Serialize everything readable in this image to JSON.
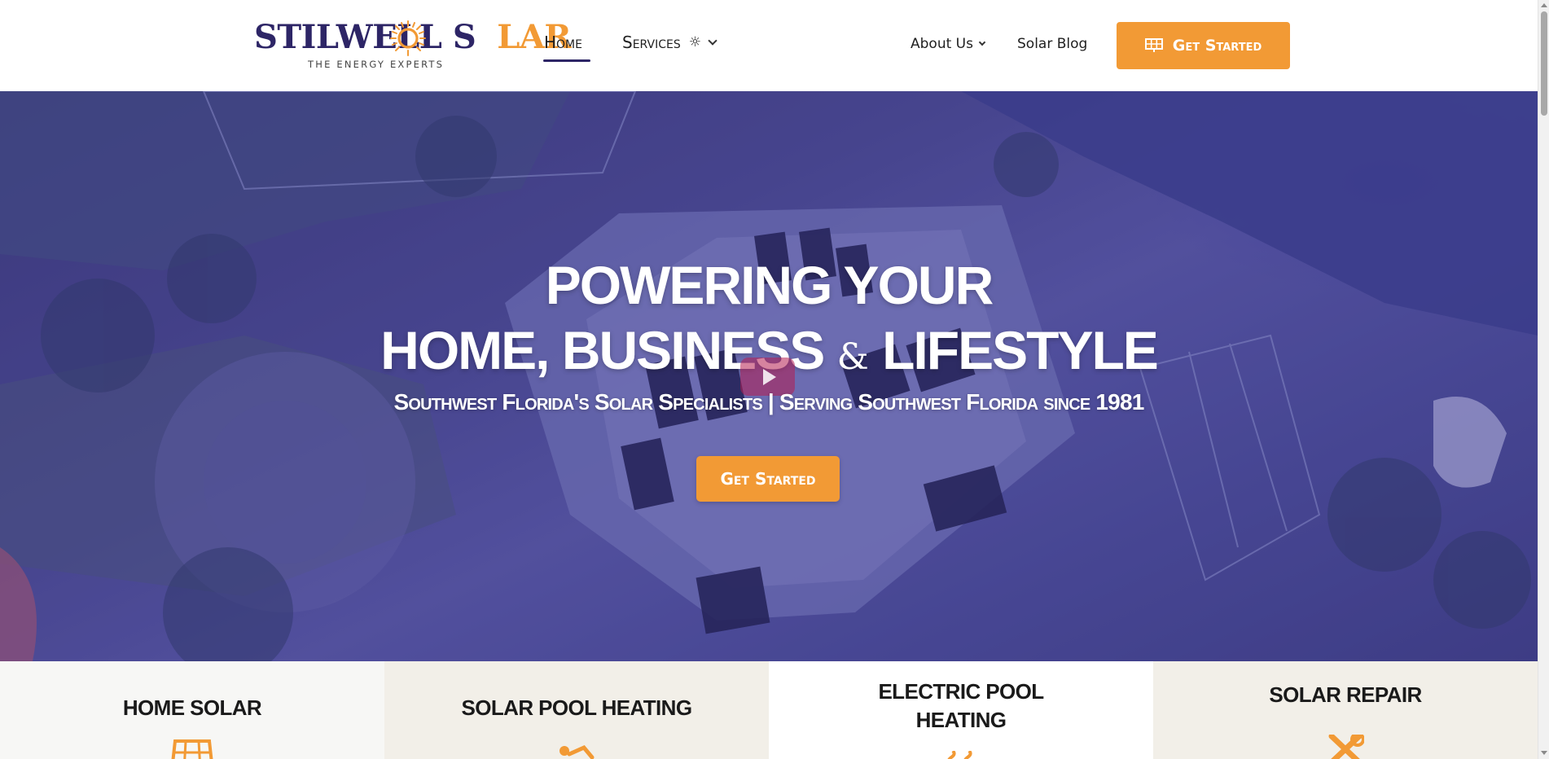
{
  "header": {
    "logo": {
      "word_part1": "STILWELL S",
      "word_part2": "LAR",
      "tagline": "THE ENERGY EXPERTS"
    },
    "nav": {
      "home": "Home",
      "services": "Services",
      "about": "About Us",
      "blog": "Solar Blog"
    },
    "cta_label": "Get Started"
  },
  "hero": {
    "title_line1": "POWERING YOUR",
    "title_line2_a": "HOME, BUSINESS ",
    "title_line2_amp": "&",
    "title_line2_b": " LIFESTYLE",
    "subtitle": "Southwest Florida's Solar Specialists | Serving Southwest Florida since 1981",
    "cta_label": "Get Started"
  },
  "services": [
    {
      "title": "HOME SOLAR",
      "icon": "solar-panel-icon"
    },
    {
      "title": "SOLAR POOL HEATING",
      "icon": "swimmer-icon"
    },
    {
      "title_line1": "ELECTRIC POOL",
      "title_line2": "HEATING",
      "icon": "heat-waves-icon"
    },
    {
      "title": "SOLAR REPAIR",
      "icon": "tools-icon"
    }
  ],
  "colors": {
    "brand_navy": "#2d2566",
    "brand_orange": "#f29a35",
    "hero_overlay": "#4a4a8a"
  }
}
